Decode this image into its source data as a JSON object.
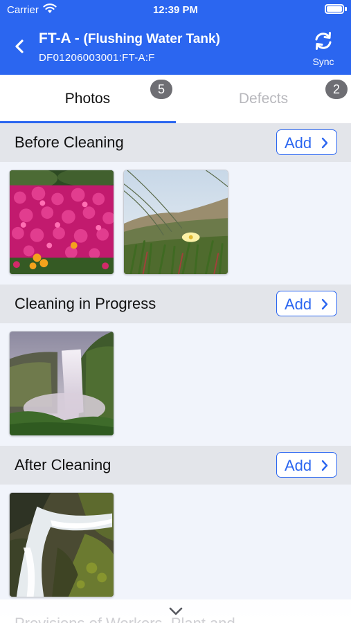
{
  "status_bar": {
    "carrier": "Carrier",
    "time": "12:39 PM"
  },
  "header": {
    "title_main": "FT-A - ",
    "title_sub": "(Flushing Water Tank)",
    "subtitle": "DF01206003001:FT-A:F",
    "sync_label": "Sync",
    "accent_color": "#2b66f0"
  },
  "tabs": [
    {
      "label": "Photos",
      "badge": "5",
      "active": true
    },
    {
      "label": "Defects",
      "badge": "2",
      "active": false
    }
  ],
  "sections": [
    {
      "title": "Before Cleaning",
      "add_label": "Add",
      "photos": [
        "flowers-photo",
        "beach-grass-photo"
      ]
    },
    {
      "title": "Cleaning in Progress",
      "add_label": "Add",
      "photos": [
        "waterfall-photo"
      ]
    },
    {
      "title": "After Cleaning",
      "add_label": "Add",
      "photos": [
        "river-photo"
      ]
    }
  ],
  "bottom": {
    "peek_title": "Provisions of Workers, Plant and"
  }
}
